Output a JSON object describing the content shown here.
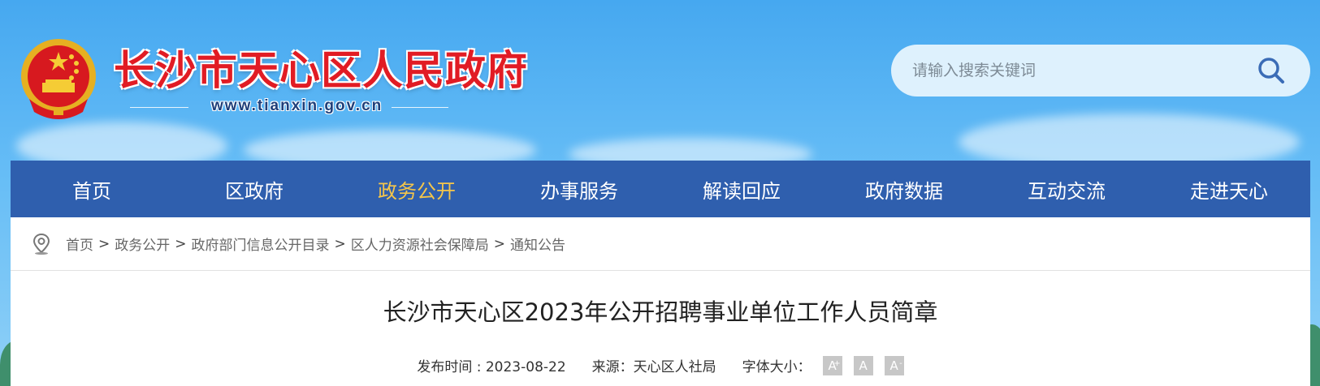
{
  "header": {
    "site_title": "长沙市天心区人民政府",
    "site_url": "www.tianxin.gov.cn"
  },
  "search": {
    "placeholder": "请输入搜索关键词"
  },
  "nav": {
    "items": [
      {
        "label": "首页"
      },
      {
        "label": "区政府"
      },
      {
        "label": "政务公开"
      },
      {
        "label": "办事服务"
      },
      {
        "label": "解读回应"
      },
      {
        "label": "政府数据"
      },
      {
        "label": "互动交流"
      },
      {
        "label": "走进天心"
      }
    ],
    "active_index": 2
  },
  "breadcrumb": {
    "separator": ">",
    "items": [
      {
        "label": "首页"
      },
      {
        "label": "政务公开"
      },
      {
        "label": "政府部门信息公开目录"
      },
      {
        "label": "区人力资源社会保障局"
      },
      {
        "label": "通知公告"
      }
    ]
  },
  "article": {
    "title": "长沙市天心区2023年公开招聘事业单位工作人员简章",
    "publish_time": "发布时间 : 2023-08-22",
    "source": "来源：天心区人社局",
    "font_size_label": "字体大小：",
    "font_buttons": {
      "increase": "A",
      "normal": "A",
      "decrease": "A"
    }
  },
  "colors": {
    "nav_bg": "#2f5fae",
    "nav_active": "#f5c64a",
    "title_red": "#e11c24"
  }
}
